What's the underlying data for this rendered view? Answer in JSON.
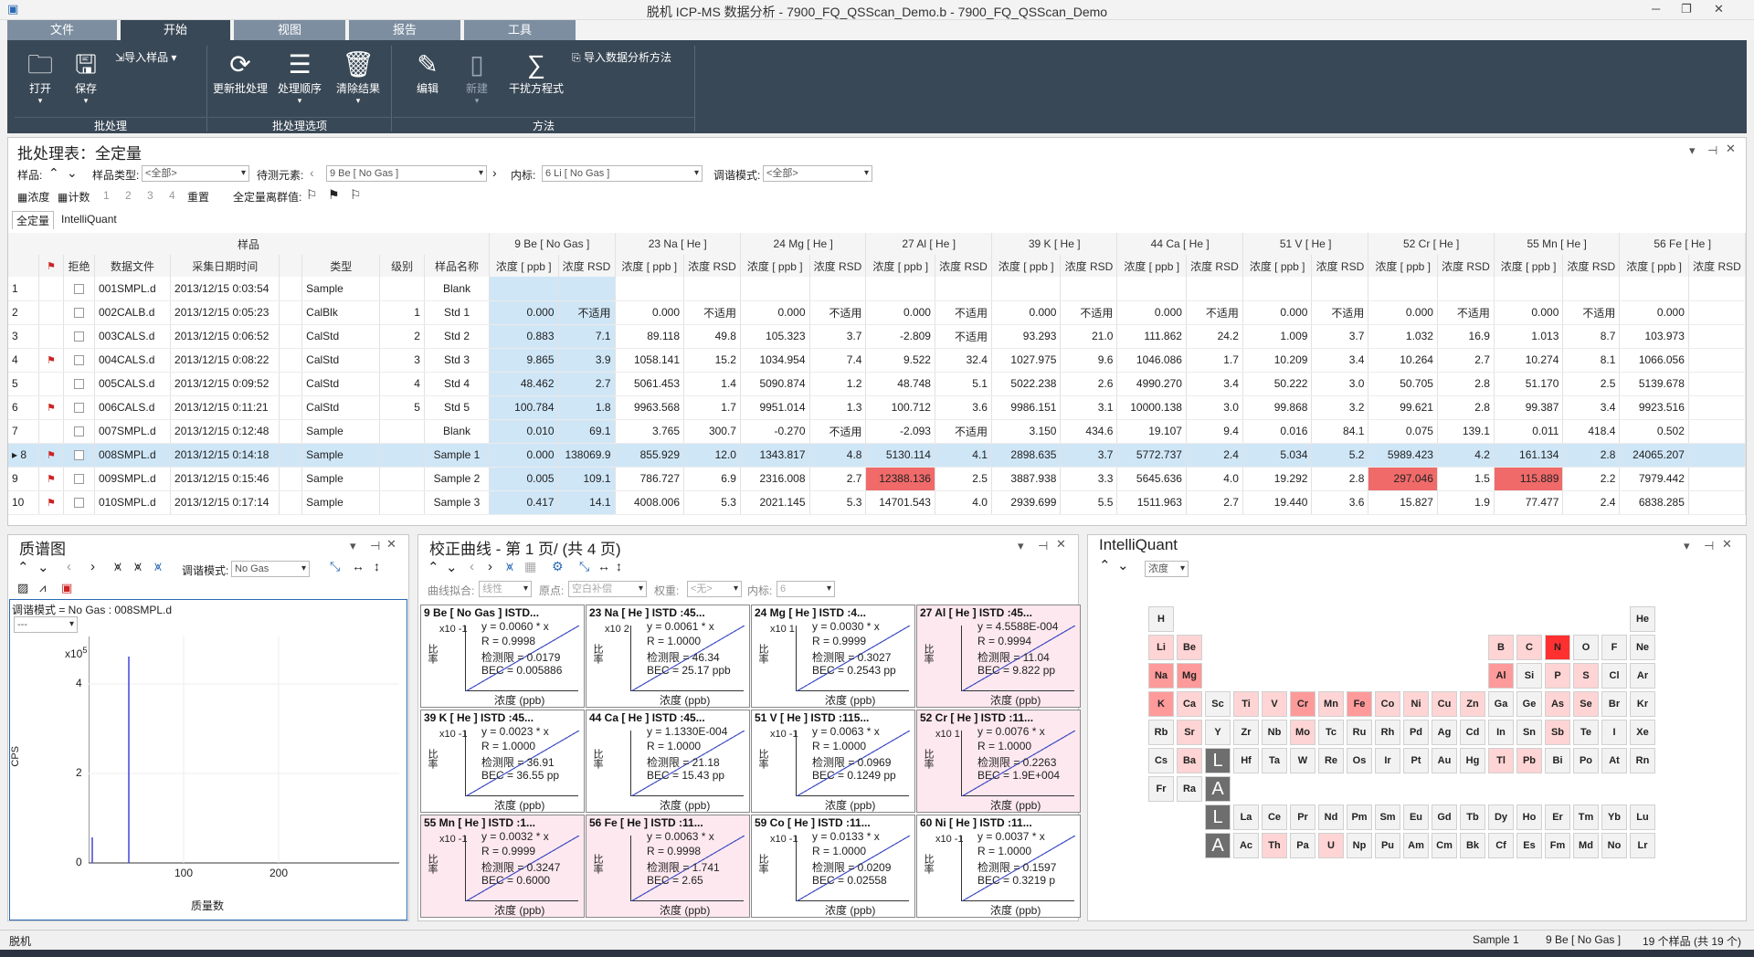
{
  "window": {
    "title": "脱机 ICP-MS 数据分析 - 7900_FQ_QSScan_Demo.b - 7900_FQ_QSScan_Demo"
  },
  "tabs": [
    "文件",
    "开始",
    "视图",
    "报告",
    "工具"
  ],
  "ribbon": {
    "open": "打开",
    "save": "保存",
    "import_sample": "导入样品",
    "update_batch": "更新批处理",
    "process_order": "处理顺序",
    "clear_results": "清除结果",
    "edit": "编辑",
    "new": "新建",
    "interference": "干扰方程式",
    "import_method": "导入数据分析方法",
    "groups": [
      "批处理",
      "批处理选项",
      "方法"
    ]
  },
  "batch": {
    "title": "批处理表：全定量",
    "sample_label": "样品:",
    "sample_type_label": "样品类型:",
    "sample_type": "<全部>",
    "element_label": "待测元素:",
    "element": "9 Be [ No Gas ]",
    "istd_label": "内标:",
    "istd": "6 Li [ No Gas ]",
    "tune_label": "调谐模式:",
    "tune": "<全部>",
    "conc": "浓度",
    "count": "计数",
    "n1": "1",
    "n2": "2",
    "n3": "3",
    "n4": "4",
    "reset": "重置",
    "outlier": "全定量离群值:",
    "subtabs": [
      "全定量",
      "IntelliQuant"
    ],
    "sample_group": "样品",
    "elements": [
      "9 Be [ No Gas ]",
      "23 Na [ He ]",
      "24 Mg [ He ]",
      "27 Al [ He ]",
      "39 K [ He ]",
      "44 Ca [ He ]",
      "51 V [ He ]",
      "52 Cr [ He ]",
      "55 Mn [ He ]",
      "56 Fe [ He ]"
    ],
    "cols": {
      "reject": "拒绝",
      "file": "数据文件",
      "date": "采集日期时间",
      "type": "类型",
      "level": "级别",
      "name": "样品名称",
      "conc": "浓度 [ ppb ]",
      "rsd": "浓度 RSD"
    },
    "rows": [
      {
        "n": "1",
        "flag": "",
        "file": "001SMPL.d",
        "date": "2013/12/15 0:03:54",
        "type": "Sample",
        "lv": "",
        "name": "Blank",
        "v": [
          "",
          "",
          "",
          "",
          "",
          "",
          "",
          "",
          "",
          "",
          "",
          "",
          "",
          "",
          "",
          "",
          "",
          "",
          "",
          ""
        ]
      },
      {
        "n": "2",
        "flag": "",
        "file": "002CALB.d",
        "date": "2013/12/15 0:05:23",
        "type": "CalBlk",
        "lv": "1",
        "name": "Std 1",
        "v": [
          "0.000",
          "不适用",
          "0.000",
          "不适用",
          "0.000",
          "不适用",
          "0.000",
          "不适用",
          "0.000",
          "不适用",
          "0.000",
          "不适用",
          "0.000",
          "不适用",
          "0.000",
          "不适用",
          "0.000",
          "不适用",
          "0.000",
          ""
        ]
      },
      {
        "n": "3",
        "flag": "",
        "file": "003CALS.d",
        "date": "2013/12/15 0:06:52",
        "type": "CalStd",
        "lv": "2",
        "name": "Std 2",
        "v": [
          "0.883",
          "7.1",
          "89.118",
          "49.8",
          "105.323",
          "3.7",
          "-2.809",
          "不适用",
          "93.293",
          "21.0",
          "111.862",
          "24.2",
          "1.009",
          "3.7",
          "1.032",
          "16.9",
          "1.013",
          "8.7",
          "103.973",
          ""
        ]
      },
      {
        "n": "4",
        "flag": "⚑",
        "file": "004CALS.d",
        "date": "2013/12/15 0:08:22",
        "type": "CalStd",
        "lv": "3",
        "name": "Std 3",
        "v": [
          "9.865",
          "3.9",
          "1058.141",
          "15.2",
          "1034.954",
          "7.4",
          "9.522",
          "32.4",
          "1027.975",
          "9.6",
          "1046.086",
          "1.7",
          "10.209",
          "3.4",
          "10.264",
          "2.7",
          "10.274",
          "8.1",
          "1066.056",
          ""
        ]
      },
      {
        "n": "5",
        "flag": "",
        "file": "005CALS.d",
        "date": "2013/12/15 0:09:52",
        "type": "CalStd",
        "lv": "4",
        "name": "Std 4",
        "v": [
          "48.462",
          "2.7",
          "5061.453",
          "1.4",
          "5090.874",
          "1.2",
          "48.748",
          "5.1",
          "5022.238",
          "2.6",
          "4990.270",
          "3.4",
          "50.222",
          "3.0",
          "50.705",
          "2.8",
          "51.170",
          "2.5",
          "5139.678",
          ""
        ]
      },
      {
        "n": "6",
        "flag": "⚑",
        "file": "006CALS.d",
        "date": "2013/12/15 0:11:21",
        "type": "CalStd",
        "lv": "5",
        "name": "Std 5",
        "v": [
          "100.784",
          "1.8",
          "9963.568",
          "1.7",
          "9951.014",
          "1.3",
          "100.712",
          "3.6",
          "9986.151",
          "3.1",
          "10000.138",
          "3.0",
          "99.868",
          "3.2",
          "99.621",
          "2.8",
          "99.387",
          "3.4",
          "9923.516",
          ""
        ]
      },
      {
        "n": "7",
        "flag": "",
        "file": "007SMPL.d",
        "date": "2013/12/15 0:12:48",
        "type": "Sample",
        "lv": "",
        "name": "Blank",
        "v": [
          "0.010",
          "69.1",
          "3.765",
          "300.7",
          "-0.270",
          "不适用",
          "-2.093",
          "不适用",
          "3.150",
          "434.6",
          "19.107",
          "9.4",
          "0.016",
          "84.1",
          "0.075",
          "139.1",
          "0.011",
          "418.4",
          "0.502",
          ""
        ]
      },
      {
        "n": "8",
        "flag": "⚑",
        "file": "008SMPL.d",
        "date": "2013/12/15 0:14:18",
        "type": "Sample",
        "lv": "",
        "name": "Sample 1",
        "v": [
          "0.000",
          "138069.9",
          "855.929",
          "12.0",
          "1343.817",
          "4.8",
          "5130.114",
          "4.1",
          "2898.635",
          "3.7",
          "5772.737",
          "2.4",
          "5.034",
          "5.2",
          "5989.423",
          "4.2",
          "161.134",
          "2.8",
          "24065.207",
          ""
        ]
      },
      {
        "n": "9",
        "flag": "⚑",
        "file": "009SMPL.d",
        "date": "2013/12/15 0:15:46",
        "type": "Sample",
        "lv": "",
        "name": "Sample 2",
        "v": [
          "0.005",
          "109.1",
          "786.727",
          "6.9",
          "2316.008",
          "2.7",
          "12388.136",
          "2.5",
          "3887.938",
          "3.3",
          "5645.636",
          "4.0",
          "19.292",
          "2.8",
          "297.046",
          "1.5",
          "115.889",
          "2.2",
          "7979.442",
          ""
        ]
      },
      {
        "n": "10",
        "flag": "⚑",
        "file": "010SMPL.d",
        "date": "2013/12/15 0:17:14",
        "type": "Sample",
        "lv": "",
        "name": "Sample 3",
        "v": [
          "0.417",
          "14.1",
          "4008.006",
          "5.3",
          "2021.145",
          "5.3",
          "14701.543",
          "4.0",
          "2939.699",
          "5.5",
          "1511.963",
          "2.7",
          "19.440",
          "3.6",
          "15.827",
          "1.9",
          "77.477",
          "2.4",
          "6838.285",
          ""
        ]
      }
    ]
  },
  "spectrum": {
    "title": "质谱图",
    "tune_label": "调谐模式:",
    "tune": "No Gas",
    "info": "调谐模式 =    No Gas : 008SMPL.d",
    "combo": "---",
    "ylabel": "CPS",
    "xlabel": "质量数",
    "yexp": "x10",
    "yexp_pow": "5",
    "yticks": [
      "4",
      "2",
      "0"
    ],
    "xticks": [
      "100",
      "200"
    ]
  },
  "calibration": {
    "title": "校正曲线 - 第 1 页/ (共 4 页)",
    "fit_label": "曲线拟合:",
    "fit": "线性",
    "origin_label": "原点:",
    "origin": "空白补偿",
    "weight_label": "权重:",
    "weight": "<无>",
    "istd_label": "内标:",
    "istd": "6",
    "ylabel": "比率",
    "xlabel": "浓度 (ppb)",
    "cells": [
      {
        "h": "9  Be  [ No Gas ]  ISTD...",
        "exp": "x10 -1",
        "l1": "y = 0.0060 * x",
        "l2": "R = 0.9998",
        "l3": "检测限 = 0.0179",
        "l4": "BEC = 0.005886",
        "pink": false
      },
      {
        "h": "23  Na  [ He ]  ISTD :45...",
        "exp": "x10 2",
        "l1": "y = 0.0061 * x",
        "l2": "R = 1.0000",
        "l3": "检测限 = 46.34",
        "l4": "BEC = 25.17 ppb",
        "pink": false
      },
      {
        "h": "24  Mg  [ He ]  ISTD :4...",
        "exp": "x10 1",
        "l1": "y = 0.0030 * x",
        "l2": "R = 0.9999",
        "l3": "检测限 = 0.3027",
        "l4": "BEC = 0.2543 pp",
        "pink": false
      },
      {
        "h": "27  Al  [ He ]  ISTD :45...",
        "exp": "",
        "l1": "y = 4.5588E-004",
        "l2": "R = 0.9994",
        "l3": "检测限 = 11.04",
        "l4": "BEC = 9.822 pp",
        "pink": true
      },
      {
        "h": "39  K  [ He ]  ISTD :45...",
        "exp": "x10 -1",
        "l1": "y = 0.0023 * x",
        "l2": "R = 1.0000",
        "l3": "检测限 = 36.91",
        "l4": "BEC = 36.55 pp",
        "pink": false
      },
      {
        "h": "44  Ca  [ He ]  ISTD :45...",
        "exp": "",
        "l1": "y = 1.1330E-004",
        "l2": "R = 1.0000",
        "l3": "检测限 = 21.18",
        "l4": "BEC = 15.43 pp",
        "pink": false
      },
      {
        "h": "51  V  [ He ]  ISTD :115...",
        "exp": "x10 -1",
        "l1": "y = 0.0063 * x",
        "l2": "R = 1.0000",
        "l3": "检测限 = 0.0969",
        "l4": "BEC = 0.1249 pp",
        "pink": false
      },
      {
        "h": "52  Cr  [ He ]  ISTD :11...",
        "exp": "x10 1",
        "l1": "y = 0.0076 * x",
        "l2": "R = 1.0000",
        "l3": "检测限 = 0.2263",
        "l4": "BEC = 1.9E+004",
        "pink": true
      },
      {
        "h": "55  Mn  [ He ]  ISTD :1...",
        "exp": "x10 -1",
        "l1": "y = 0.0032 * x",
        "l2": "R = 0.9999",
        "l3": "检测限 = 0.3247",
        "l4": "BEC = 0.6000",
        "pink": true
      },
      {
        "h": "56  Fe  [ He ]  ISTD :11...",
        "exp": "",
        "l1": "y = 0.0063 * x",
        "l2": "R = 0.9998",
        "l3": "检测限 = 1.741",
        "l4": "BEC = 2.65",
        "pink": true
      },
      {
        "h": "59  Co  [ He ]  ISTD :11...",
        "exp": "x10 -1",
        "l1": "y = 0.0133 * x",
        "l2": "R = 1.0000",
        "l3": "检测限 = 0.0209",
        "l4": "BEC = 0.02558",
        "pink": false
      },
      {
        "h": "60  Ni  [ He ]  ISTD :11...",
        "exp": "x10 -1",
        "l1": "y = 0.0037 * x",
        "l2": "R = 1.0000",
        "l3": "检测限 = 0.1597",
        "l4": "BEC = 0.3219 p",
        "pink": false
      }
    ]
  },
  "intelliquant": {
    "title": "IntelliQuant",
    "mode": "浓度"
  },
  "status": {
    "left": "脱机",
    "sample": "Sample 1",
    "element": "9 Be [ No Gas ]",
    "count": "19 个样品 (共 19 个)"
  },
  "periodic": [
    [
      "H",
      "He"
    ],
    [
      "Li",
      "Be",
      "B",
      "C",
      "N",
      "O",
      "F",
      "Ne"
    ],
    [
      "Na",
      "Mg",
      "Al",
      "Si",
      "P",
      "S",
      "Cl",
      "Ar"
    ],
    [
      "K",
      "Ca",
      "Sc",
      "Ti",
      "V",
      "Cr",
      "Mn",
      "Fe",
      "Co",
      "Ni",
      "Cu",
      "Zn",
      "Ga",
      "Ge",
      "As",
      "Se",
      "Br",
      "Kr"
    ],
    [
      "Rb",
      "Sr",
      "Y",
      "Zr",
      "Nb",
      "Mo",
      "Tc",
      "Ru",
      "Rh",
      "Pd",
      "Ag",
      "Cd",
      "In",
      "Sn",
      "Sb",
      "Te",
      "I",
      "Xe"
    ],
    [
      "Cs",
      "Ba",
      "L",
      "Hf",
      "Ta",
      "W",
      "Re",
      "Os",
      "Ir",
      "Pt",
      "Au",
      "Hg",
      "Tl",
      "Pb",
      "Bi",
      "Po",
      "At",
      "Rn"
    ],
    [
      "Fr",
      "Ra",
      "A"
    ],
    [
      "L",
      "La",
      "Ce",
      "Pr",
      "Nd",
      "Pm",
      "Sm",
      "Eu",
      "Gd",
      "Tb",
      "Dy",
      "Ho",
      "Er",
      "Tm",
      "Yb",
      "Lu"
    ],
    [
      "A",
      "Ac",
      "Th",
      "Pa",
      "U",
      "Np",
      "Pu",
      "Am",
      "Cm",
      "Bk",
      "Cf",
      "Es",
      "Fm",
      "Md",
      "No",
      "Lr"
    ]
  ]
}
